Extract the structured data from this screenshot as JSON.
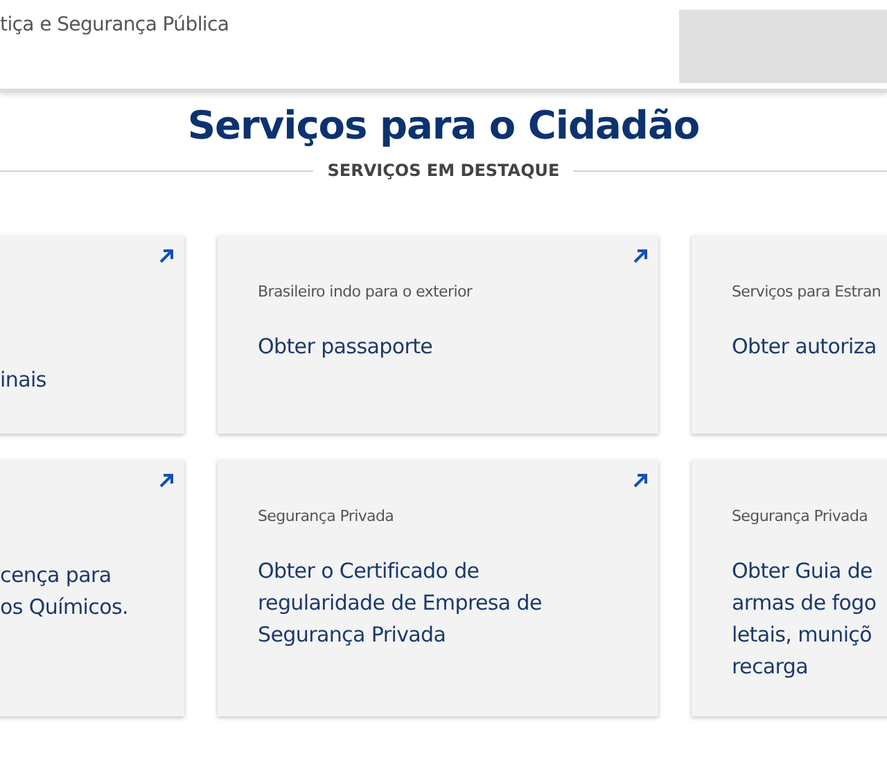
{
  "header": {
    "org_name": "tiça e Segurança Pública"
  },
  "page_title": "Serviços para o Cidadão",
  "section_label": "SERVIÇOS EM DESTAQUE",
  "card_rows": [
    [
      {
        "kind": "cut_left",
        "title": "inais"
      },
      {
        "kind": "full",
        "category": "Brasileiro indo para o exterior",
        "title": "Obter passaporte"
      },
      {
        "kind": "cut_right",
        "category": "Serviços para Estran",
        "title": "Obter autoriza"
      }
    ],
    [
      {
        "kind": "cut_left",
        "title": "cença para\nos Químicos."
      },
      {
        "kind": "full",
        "category": "Segurança Privada",
        "title": "Obter o Certificado de\nregularidade de Empresa de\nSegurança Privada"
      },
      {
        "kind": "cut_right",
        "category": "Segurança Privada",
        "title": "Obter Guia de\narmas de fogo\nletais, muniçõ\nrecarga"
      }
    ]
  ]
}
